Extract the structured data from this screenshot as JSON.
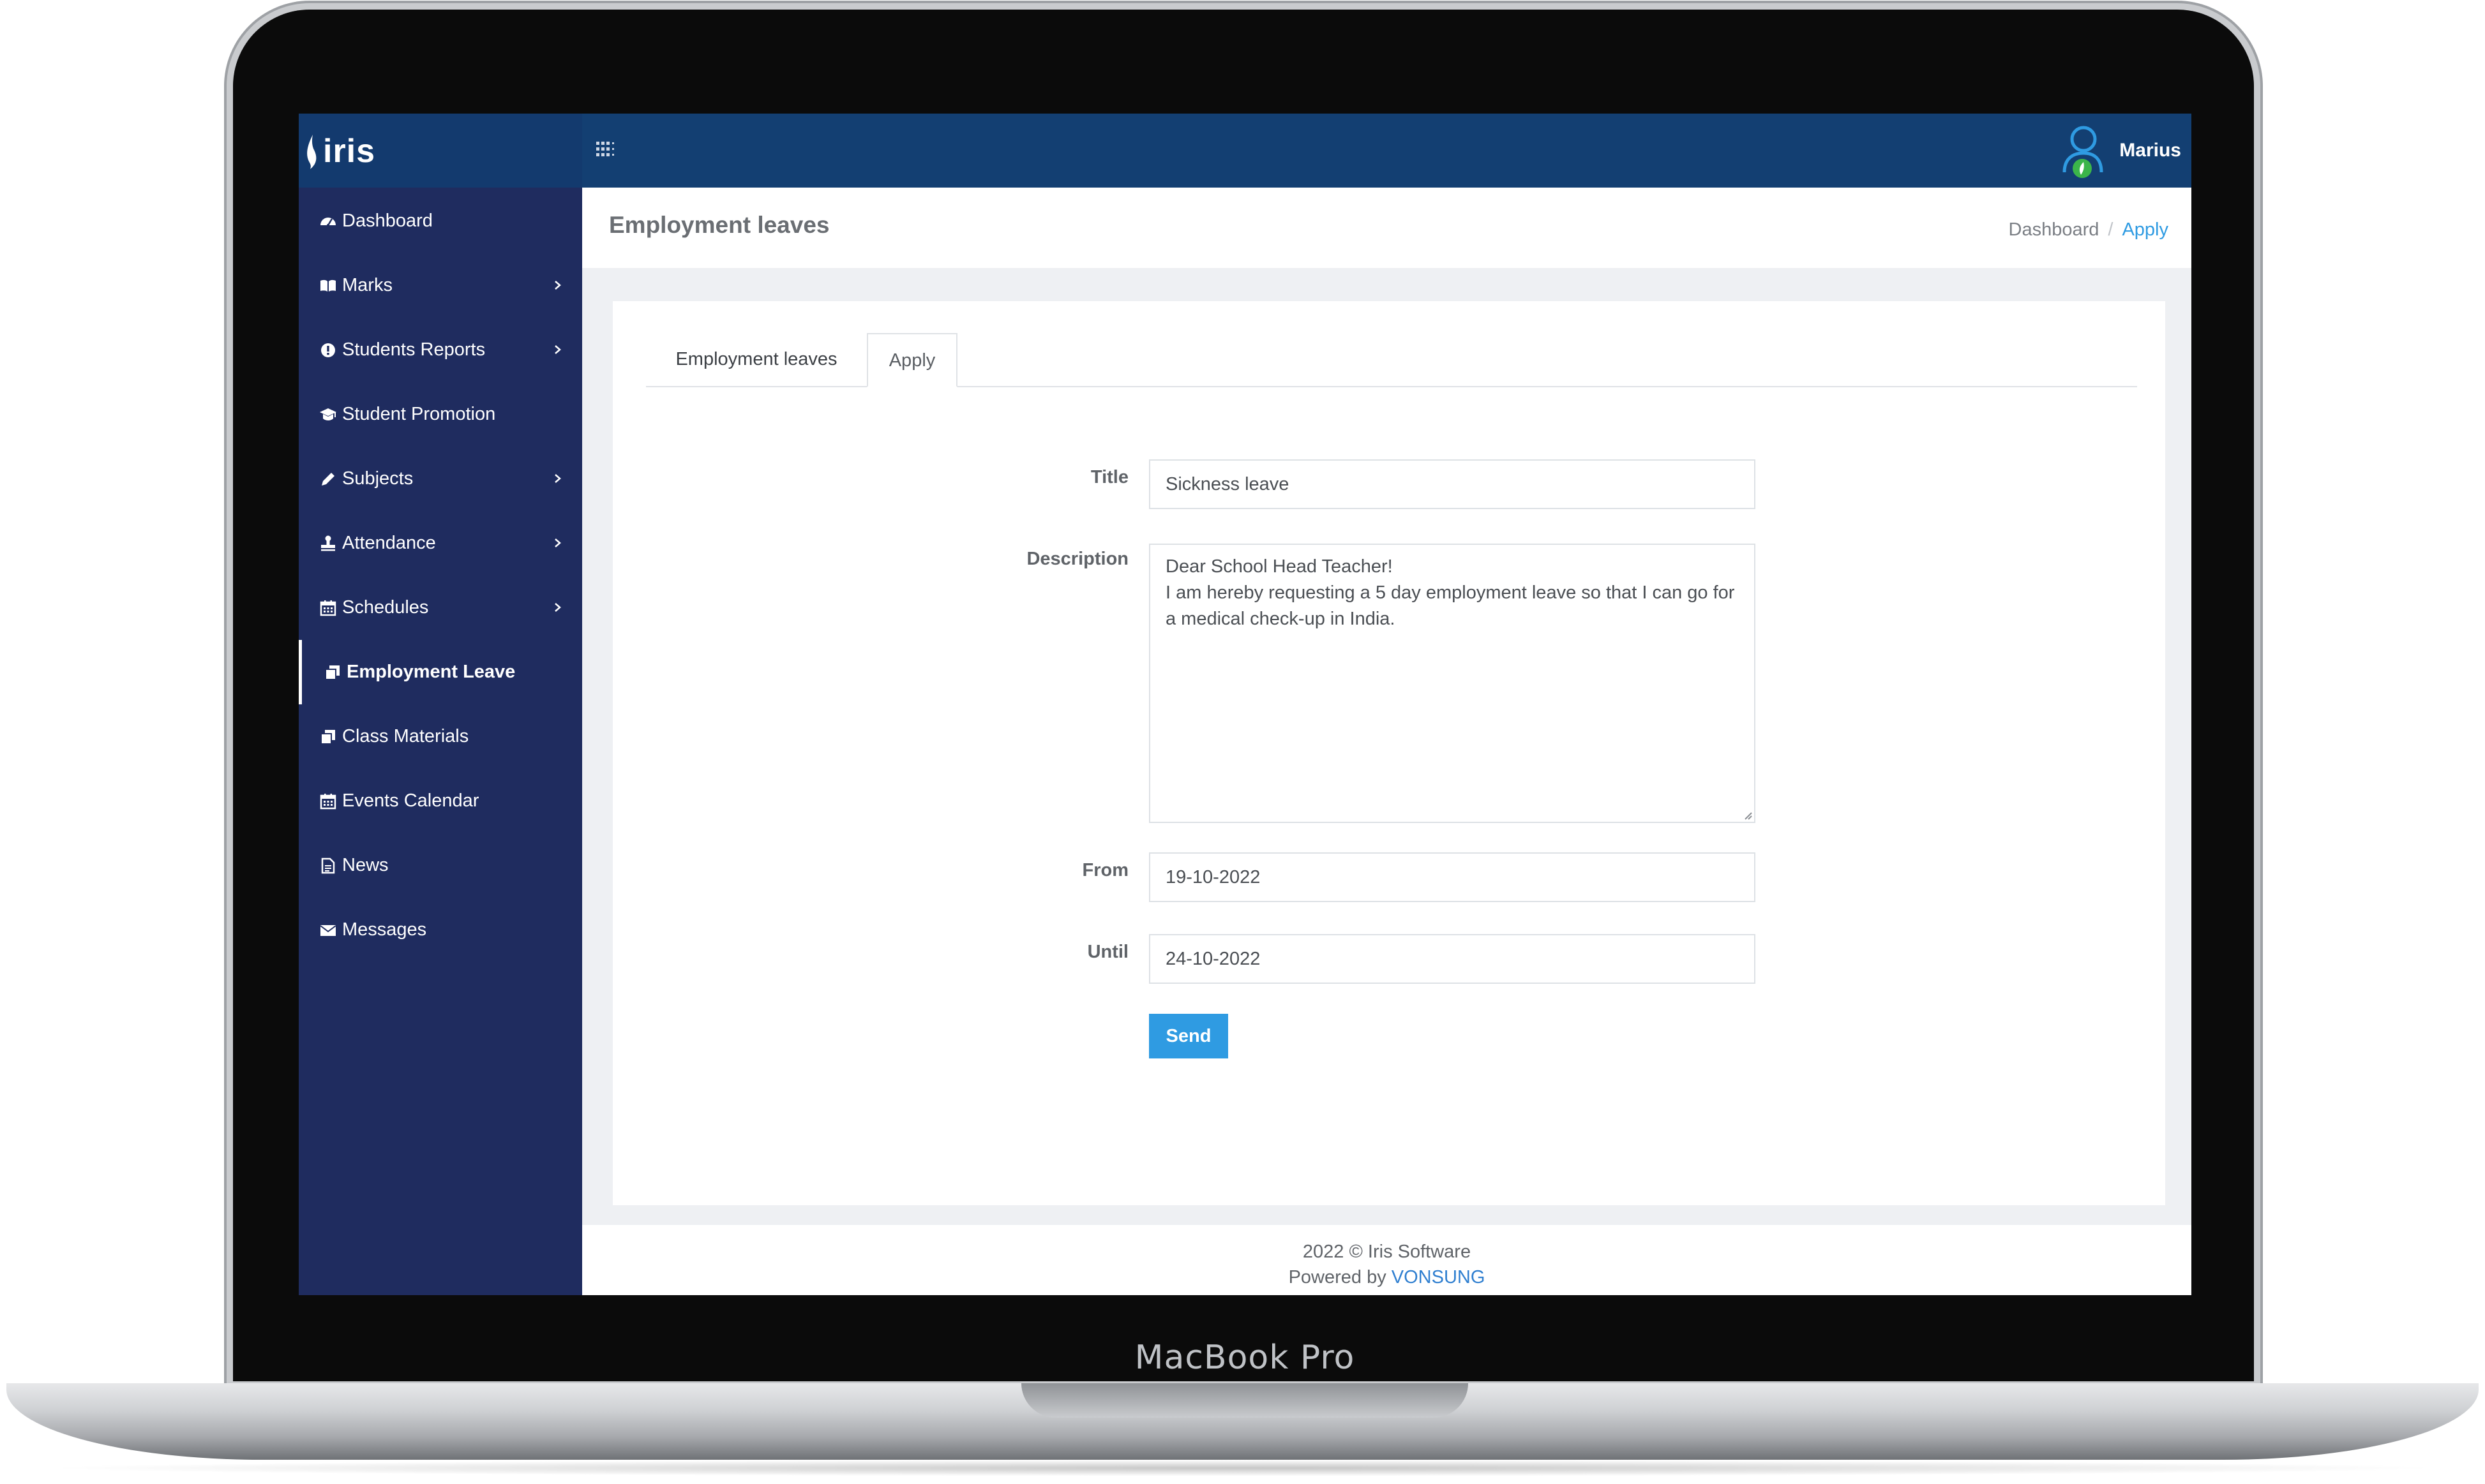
{
  "device": {
    "model_label": "MacBook Pro"
  },
  "app": {
    "logo_text": "iris"
  },
  "topbar": {
    "user_name": "Marius"
  },
  "sidebar": {
    "items": [
      {
        "label": "Dashboard",
        "icon": "dashboard-icon",
        "chevron": false,
        "active": false
      },
      {
        "label": "Marks",
        "icon": "book-icon",
        "chevron": true,
        "active": false
      },
      {
        "label": "Students Reports",
        "icon": "info-circle-icon",
        "chevron": true,
        "active": false
      },
      {
        "label": "Student Promotion",
        "icon": "graduation-cap-icon",
        "chevron": false,
        "active": false
      },
      {
        "label": "Subjects",
        "icon": "pencil-icon",
        "chevron": true,
        "active": false
      },
      {
        "label": "Attendance",
        "icon": "stamp-icon",
        "chevron": true,
        "active": false
      },
      {
        "label": "Schedules",
        "icon": "calendar-icon",
        "chevron": true,
        "active": false
      },
      {
        "label": "Employment Leave",
        "icon": "copy-icon",
        "chevron": false,
        "active": true
      },
      {
        "label": "Class Materials",
        "icon": "copy-icon",
        "chevron": false,
        "active": false
      },
      {
        "label": "Events Calendar",
        "icon": "calendar-icon",
        "chevron": false,
        "active": false
      },
      {
        "label": "News",
        "icon": "file-icon",
        "chevron": false,
        "active": false
      },
      {
        "label": "Messages",
        "icon": "envelope-icon",
        "chevron": false,
        "active": false
      }
    ]
  },
  "header": {
    "title": "Employment leaves",
    "breadcrumb": {
      "home": "Dashboard",
      "separator": "/",
      "current": "Apply"
    }
  },
  "tabs": [
    {
      "label": "Employment leaves",
      "active": false
    },
    {
      "label": "Apply",
      "active": true
    }
  ],
  "form": {
    "title_label": "Title",
    "title_value": "Sickness leave",
    "description_label": "Description",
    "description_value": "Dear School Head Teacher!\nI am hereby requesting a 5 day employment leave so that I can go for a medical check-up in India.",
    "from_label": "From",
    "from_value": "19-10-2022",
    "until_label": "Until",
    "until_value": "24-10-2022",
    "submit_label": "Send"
  },
  "footer": {
    "copyright": "2022 © Iris Software",
    "powered_prefix": "Powered by ",
    "powered_link": "VONSUNG"
  },
  "colors": {
    "sidebar_bg": "#1f2c5f",
    "topbar_bg": "#133f72",
    "accent": "#2f9be2",
    "avatar_badge": "#3bb54a"
  }
}
